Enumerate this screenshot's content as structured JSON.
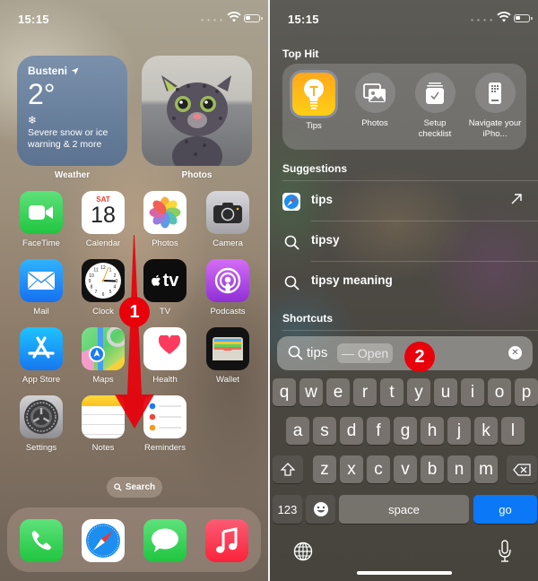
{
  "left_screen": {
    "status": {
      "time": "15:15"
    },
    "widgets": {
      "weather": {
        "city": "Busteni",
        "temperature": "2°",
        "condition_icon": "snowflake-icon",
        "alert": "Severe snow or ice warning & 2 more",
        "label": "Weather"
      },
      "photos": {
        "label": "Photos"
      }
    },
    "apps": [
      {
        "label": "FaceTime",
        "icon": "facetime-icon"
      },
      {
        "label": "Calendar",
        "icon": "calendar-icon",
        "day": "SAT",
        "date": "18"
      },
      {
        "label": "Photos",
        "icon": "photos-icon"
      },
      {
        "label": "Camera",
        "icon": "camera-icon"
      },
      {
        "label": "Mail",
        "icon": "mail-icon"
      },
      {
        "label": "Clock",
        "icon": "clock-icon"
      },
      {
        "label": "TV",
        "icon": "appletv-icon",
        "glyph": "tv"
      },
      {
        "label": "Podcasts",
        "icon": "podcasts-icon"
      },
      {
        "label": "App Store",
        "icon": "appstore-icon"
      },
      {
        "label": "Maps",
        "icon": "maps-icon"
      },
      {
        "label": "Health",
        "icon": "health-icon"
      },
      {
        "label": "Wallet",
        "icon": "wallet-icon"
      },
      {
        "label": "Settings",
        "icon": "settings-icon"
      },
      {
        "label": "Notes",
        "icon": "notes-icon"
      },
      {
        "label": "Reminders",
        "icon": "reminders-icon"
      }
    ],
    "search_pill": {
      "label": "Search"
    },
    "dock": [
      {
        "name": "Phone",
        "icon": "phone-icon"
      },
      {
        "name": "Safari",
        "icon": "safari-icon"
      },
      {
        "name": "Messages",
        "icon": "messages-icon"
      },
      {
        "name": "Music",
        "icon": "music-icon"
      }
    ],
    "annotation": {
      "badge": "1",
      "color": "#e8000b"
    }
  },
  "right_screen": {
    "status": {
      "time": "15:15"
    },
    "top_hit": {
      "title": "Top Hit",
      "items": [
        {
          "label": "Tips",
          "icon": "tips-lightbulb-icon"
        },
        {
          "label": "Photos",
          "icon": "photos-stack-icon"
        },
        {
          "label": "Setup checklist",
          "icon": "checklist-icon"
        },
        {
          "label": "Navigate your iPho...",
          "icon": "iphone-grid-icon"
        }
      ]
    },
    "suggestions": {
      "title": "Suggestions",
      "items": [
        {
          "text": "tips",
          "icon": "safari-icon",
          "action": "open-arrow-icon"
        },
        {
          "text": "tipsy",
          "icon": "search-icon"
        },
        {
          "text": "tipsy meaning",
          "icon": "search-icon"
        }
      ]
    },
    "shortcuts": {
      "title": "Shortcuts"
    },
    "search_field": {
      "value": "tips",
      "completion_hint": "— Open"
    },
    "annotation": {
      "badge": "2"
    },
    "keyboard": {
      "row1": [
        "q",
        "w",
        "e",
        "r",
        "t",
        "y",
        "u",
        "i",
        "o",
        "p"
      ],
      "row2": [
        "a",
        "s",
        "d",
        "f",
        "g",
        "h",
        "j",
        "k",
        "l"
      ],
      "row3": [
        "z",
        "x",
        "c",
        "v",
        "b",
        "n",
        "m"
      ],
      "numbers_key": "123",
      "space_key": "space",
      "go_key": "go",
      "go_color": "#0a78f7"
    }
  }
}
